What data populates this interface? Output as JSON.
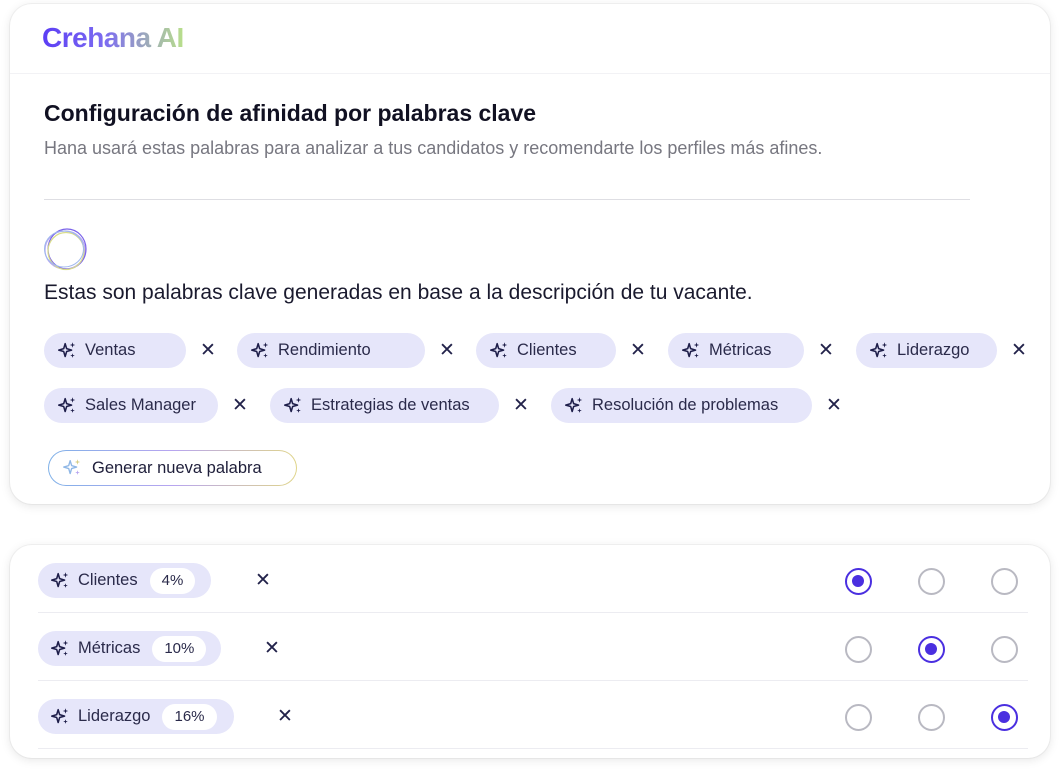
{
  "brand": {
    "name": "Crehana AI"
  },
  "header": {
    "title": "Configuración de afinidad por palabras clave",
    "subtitle": "Hana usará estas palabras para analizar a tus candidatos y recomendarte los perfiles más afines."
  },
  "generated": {
    "lead": "Estas son palabras clave generadas en base a la descripción de tu vacante.",
    "keywords": [
      "Ventas",
      "Rendimiento",
      "Clientes",
      "Métricas",
      "Liderazgo",
      "Sales Manager",
      "Estrategias de ventas",
      "Resolución de problemas"
    ],
    "remove_symbol": "✕",
    "generate_label": "Generar nueva palabra"
  },
  "affinity": {
    "rows": [
      {
        "keyword": "Clientes",
        "percent": "4%",
        "selected_level": 1
      },
      {
        "keyword": "Métricas",
        "percent": "10%",
        "selected_level": 2
      },
      {
        "keyword": "Liderazgo",
        "percent": "16%",
        "selected_level": 3
      }
    ],
    "level_count": 3
  },
  "colors": {
    "accent": "#4a2fe0",
    "chip_bg": "#e6e6fa",
    "muted_text": "#777780"
  },
  "icons": {
    "keyword": "sparkle-icon",
    "remove": "close-icon",
    "generate": "sparkle-icon",
    "radio": "radio-icon"
  }
}
